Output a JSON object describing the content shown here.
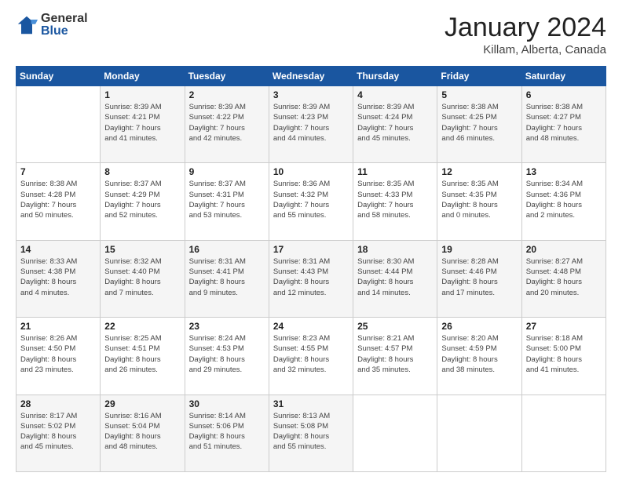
{
  "logo": {
    "general": "General",
    "blue": "Blue"
  },
  "title": "January 2024",
  "location": "Killam, Alberta, Canada",
  "days_header": [
    "Sunday",
    "Monday",
    "Tuesday",
    "Wednesday",
    "Thursday",
    "Friday",
    "Saturday"
  ],
  "weeks": [
    [
      {
        "day": "",
        "info": ""
      },
      {
        "day": "1",
        "info": "Sunrise: 8:39 AM\nSunset: 4:21 PM\nDaylight: 7 hours\nand 41 minutes."
      },
      {
        "day": "2",
        "info": "Sunrise: 8:39 AM\nSunset: 4:22 PM\nDaylight: 7 hours\nand 42 minutes."
      },
      {
        "day": "3",
        "info": "Sunrise: 8:39 AM\nSunset: 4:23 PM\nDaylight: 7 hours\nand 44 minutes."
      },
      {
        "day": "4",
        "info": "Sunrise: 8:39 AM\nSunset: 4:24 PM\nDaylight: 7 hours\nand 45 minutes."
      },
      {
        "day": "5",
        "info": "Sunrise: 8:38 AM\nSunset: 4:25 PM\nDaylight: 7 hours\nand 46 minutes."
      },
      {
        "day": "6",
        "info": "Sunrise: 8:38 AM\nSunset: 4:27 PM\nDaylight: 7 hours\nand 48 minutes."
      }
    ],
    [
      {
        "day": "7",
        "info": "Sunrise: 8:38 AM\nSunset: 4:28 PM\nDaylight: 7 hours\nand 50 minutes."
      },
      {
        "day": "8",
        "info": "Sunrise: 8:37 AM\nSunset: 4:29 PM\nDaylight: 7 hours\nand 52 minutes."
      },
      {
        "day": "9",
        "info": "Sunrise: 8:37 AM\nSunset: 4:31 PM\nDaylight: 7 hours\nand 53 minutes."
      },
      {
        "day": "10",
        "info": "Sunrise: 8:36 AM\nSunset: 4:32 PM\nDaylight: 7 hours\nand 55 minutes."
      },
      {
        "day": "11",
        "info": "Sunrise: 8:35 AM\nSunset: 4:33 PM\nDaylight: 7 hours\nand 58 minutes."
      },
      {
        "day": "12",
        "info": "Sunrise: 8:35 AM\nSunset: 4:35 PM\nDaylight: 8 hours\nand 0 minutes."
      },
      {
        "day": "13",
        "info": "Sunrise: 8:34 AM\nSunset: 4:36 PM\nDaylight: 8 hours\nand 2 minutes."
      }
    ],
    [
      {
        "day": "14",
        "info": "Sunrise: 8:33 AM\nSunset: 4:38 PM\nDaylight: 8 hours\nand 4 minutes."
      },
      {
        "day": "15",
        "info": "Sunrise: 8:32 AM\nSunset: 4:40 PM\nDaylight: 8 hours\nand 7 minutes."
      },
      {
        "day": "16",
        "info": "Sunrise: 8:31 AM\nSunset: 4:41 PM\nDaylight: 8 hours\nand 9 minutes."
      },
      {
        "day": "17",
        "info": "Sunrise: 8:31 AM\nSunset: 4:43 PM\nDaylight: 8 hours\nand 12 minutes."
      },
      {
        "day": "18",
        "info": "Sunrise: 8:30 AM\nSunset: 4:44 PM\nDaylight: 8 hours\nand 14 minutes."
      },
      {
        "day": "19",
        "info": "Sunrise: 8:28 AM\nSunset: 4:46 PM\nDaylight: 8 hours\nand 17 minutes."
      },
      {
        "day": "20",
        "info": "Sunrise: 8:27 AM\nSunset: 4:48 PM\nDaylight: 8 hours\nand 20 minutes."
      }
    ],
    [
      {
        "day": "21",
        "info": "Sunrise: 8:26 AM\nSunset: 4:50 PM\nDaylight: 8 hours\nand 23 minutes."
      },
      {
        "day": "22",
        "info": "Sunrise: 8:25 AM\nSunset: 4:51 PM\nDaylight: 8 hours\nand 26 minutes."
      },
      {
        "day": "23",
        "info": "Sunrise: 8:24 AM\nSunset: 4:53 PM\nDaylight: 8 hours\nand 29 minutes."
      },
      {
        "day": "24",
        "info": "Sunrise: 8:23 AM\nSunset: 4:55 PM\nDaylight: 8 hours\nand 32 minutes."
      },
      {
        "day": "25",
        "info": "Sunrise: 8:21 AM\nSunset: 4:57 PM\nDaylight: 8 hours\nand 35 minutes."
      },
      {
        "day": "26",
        "info": "Sunrise: 8:20 AM\nSunset: 4:59 PM\nDaylight: 8 hours\nand 38 minutes."
      },
      {
        "day": "27",
        "info": "Sunrise: 8:18 AM\nSunset: 5:00 PM\nDaylight: 8 hours\nand 41 minutes."
      }
    ],
    [
      {
        "day": "28",
        "info": "Sunrise: 8:17 AM\nSunset: 5:02 PM\nDaylight: 8 hours\nand 45 minutes."
      },
      {
        "day": "29",
        "info": "Sunrise: 8:16 AM\nSunset: 5:04 PM\nDaylight: 8 hours\nand 48 minutes."
      },
      {
        "day": "30",
        "info": "Sunrise: 8:14 AM\nSunset: 5:06 PM\nDaylight: 8 hours\nand 51 minutes."
      },
      {
        "day": "31",
        "info": "Sunrise: 8:13 AM\nSunset: 5:08 PM\nDaylight: 8 hours\nand 55 minutes."
      },
      {
        "day": "",
        "info": ""
      },
      {
        "day": "",
        "info": ""
      },
      {
        "day": "",
        "info": ""
      }
    ]
  ]
}
